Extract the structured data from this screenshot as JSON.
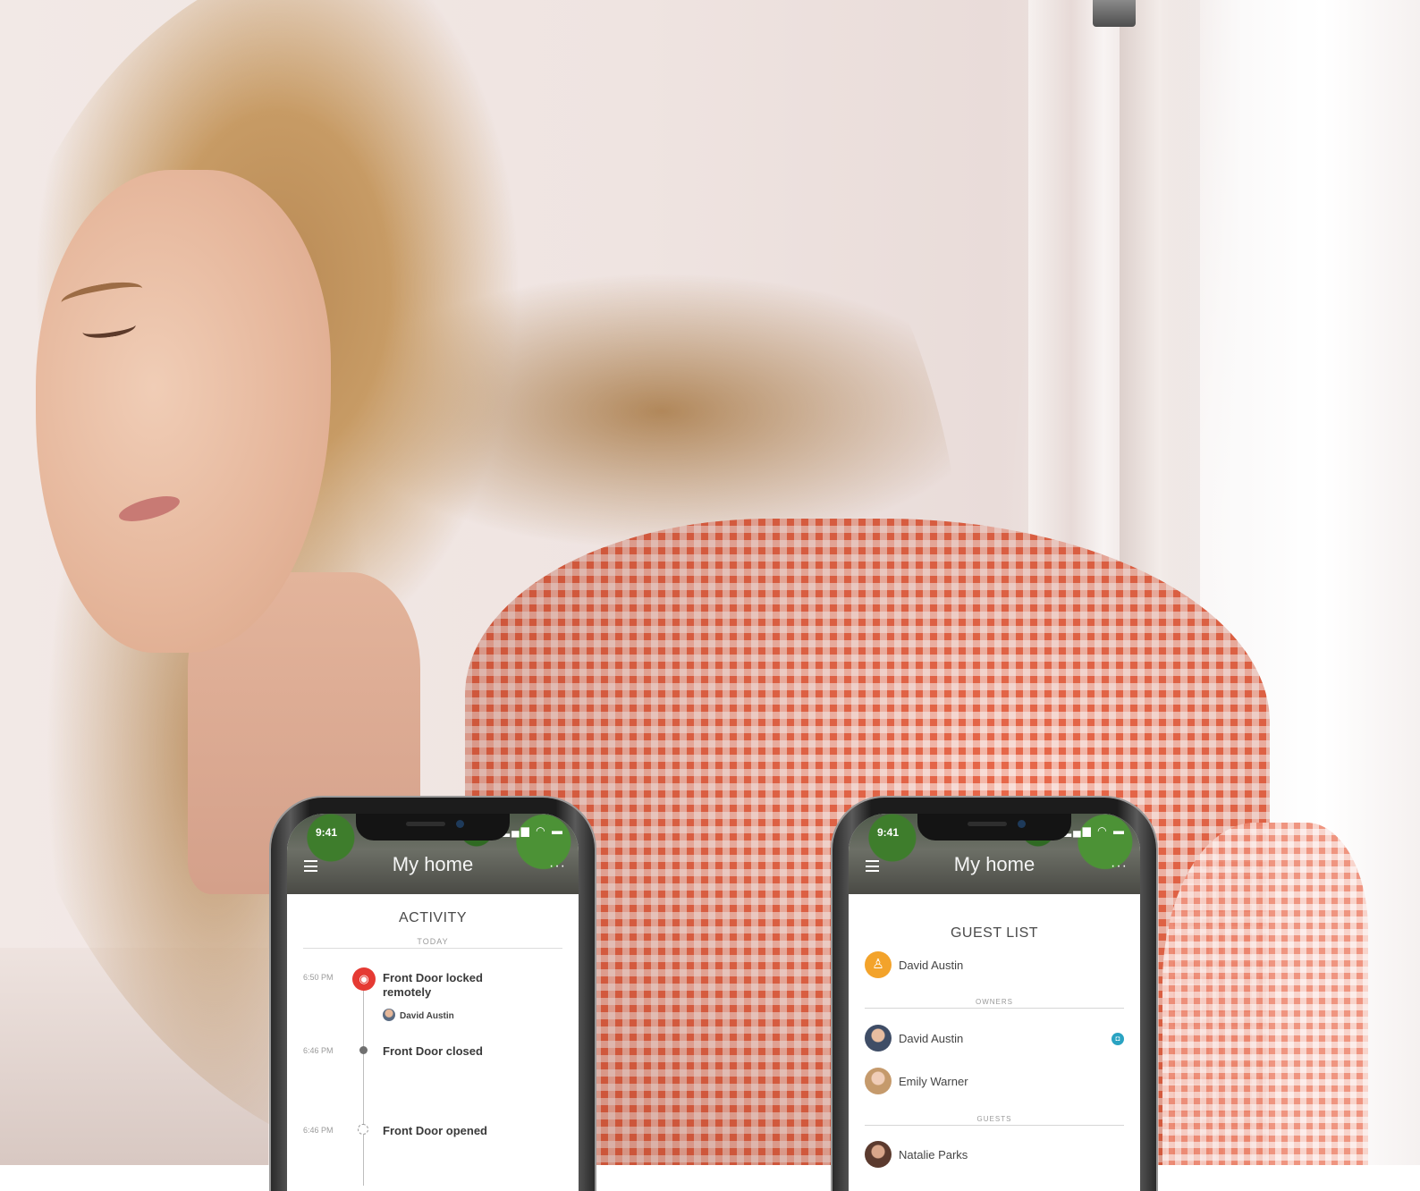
{
  "colors": {
    "accent_red": "#e53a33",
    "owner_orange": "#f3a32b",
    "badge_teal": "#2aa3c2",
    "shirt_orange": "#e8684a"
  },
  "phone_left": {
    "status_time": "9:41",
    "status_icons": "signal-wifi-battery",
    "header_title": "My home",
    "screen_title": "ACTIVITY",
    "day_label": "TODAY",
    "events": [
      {
        "time": "6:50 PM",
        "text": "Front Door locked remotely",
        "user": "David Austin",
        "icon": "wifi-icon"
      },
      {
        "time": "6:46 PM",
        "text": "Front Door closed",
        "icon": "dot-icon"
      },
      {
        "time": "6:46 PM",
        "text": "Front Door opened",
        "icon": "dashed-circle-icon"
      }
    ]
  },
  "phone_right": {
    "status_time": "9:41",
    "header_title": "My home",
    "screen_title": "GUEST LIST",
    "top_user": "David Austin",
    "owners_label": "OWNERS",
    "owners": [
      "David Austin",
      "Emily Warner"
    ],
    "guests_label": "GUESTS",
    "guests": [
      "Natalie Parks"
    ]
  }
}
